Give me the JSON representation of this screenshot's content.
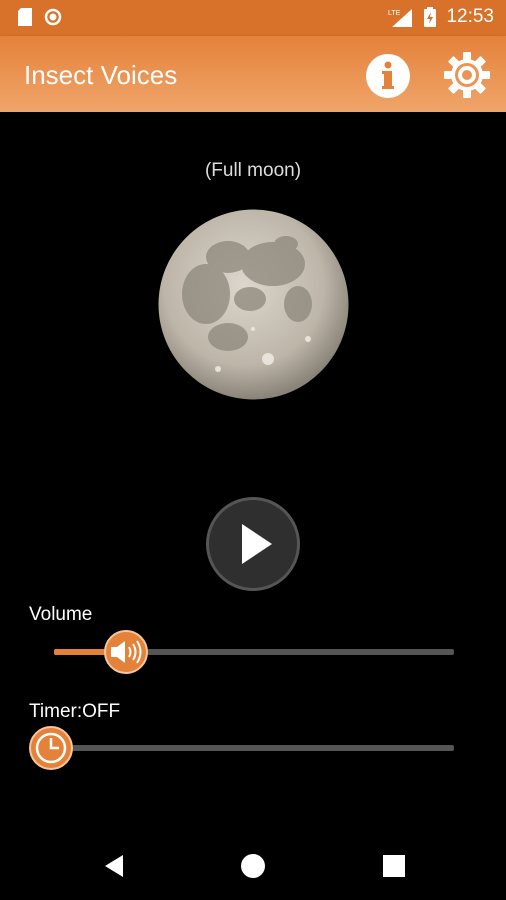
{
  "status_bar": {
    "time": "12:53",
    "network": "LTE",
    "icons": [
      "sd-card-icon",
      "circle-notification-icon",
      "lte-signal-icon",
      "battery-charging-icon"
    ]
  },
  "app_bar": {
    "title": "Insect Voices",
    "actions": [
      "info-icon",
      "settings-gear-icon"
    ]
  },
  "moon": {
    "phase_label": "(Full moon)"
  },
  "player": {
    "play_icon": "play-icon"
  },
  "volume": {
    "label": "Volume",
    "level": 0.18,
    "thumb_icon": "speaker-volume-icon"
  },
  "timer": {
    "label": "Timer:OFF",
    "level": 0,
    "thumb_icon": "clock-icon"
  },
  "nav": {
    "items": [
      "back-icon",
      "home-icon",
      "recents-icon"
    ]
  },
  "colors": {
    "accent": "#e4823a",
    "status_bar": "#d8722b",
    "background": "#000000",
    "track": "#555555"
  }
}
